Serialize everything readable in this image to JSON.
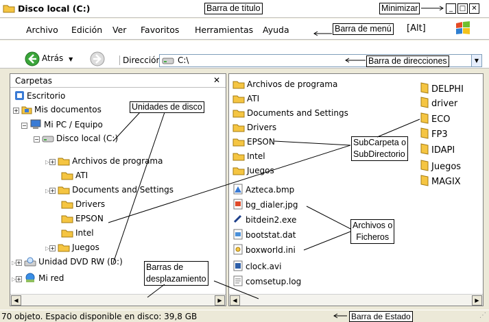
{
  "window": {
    "title": "Disco local (C:)"
  },
  "menubar": {
    "items": [
      "Archivo",
      "Edición",
      "Ver",
      "Favoritos",
      "Herramientas",
      "Ayuda"
    ]
  },
  "toolbar": {
    "back_label": "Atrás",
    "address_label": "Dirección",
    "address_value": "C:\\"
  },
  "folders_pane": {
    "title": "Carpetas",
    "close_glyph": "✕",
    "tree": [
      {
        "label": "Escritorio"
      },
      {
        "label": "Mis documentos"
      },
      {
        "label": "Mi PC / Equipo"
      },
      {
        "label": "Disco local (C:)"
      },
      {
        "label": "Archivos de programa"
      },
      {
        "label": "ATI"
      },
      {
        "label": "Documents and Settings"
      },
      {
        "label": "Drivers"
      },
      {
        "label": "EPSON"
      },
      {
        "label": "Intel"
      },
      {
        "label": "Juegos"
      },
      {
        "label": "Unidad DVD RW (D:)"
      },
      {
        "label": "Mi red"
      }
    ]
  },
  "contents": {
    "folders": [
      "Archivos de programa",
      "ATI",
      "Documents and Settings",
      "Drivers",
      "EPSON",
      "Intel",
      "Juegos"
    ],
    "files": [
      "Azteca.bmp",
      "bg_dialer.jpg",
      "bitdein2.exe",
      "bootstat.dat",
      "boxworld.ini",
      "clock.avi",
      "comsetup.log"
    ],
    "folders_right": [
      "DELPHI",
      "driver",
      "ECO",
      "FP3",
      "IDAPI",
      "Juegos",
      "MAGIX"
    ]
  },
  "status": {
    "text": "70 objeto. Espacio disponible en disco:  39,8 GB"
  },
  "annotations": {
    "title_bar": "Barra de título",
    "minimize": "Minimizar",
    "menu_bar": "Barra de menú",
    "menu_bar_key": "[Alt]",
    "address_bar": "Barra de direcciones",
    "drive_units": "Unidades de disco",
    "subfolder_1": "SubCarpeta o",
    "subfolder_2": "SubDirectorio",
    "files_1": "Archivos o",
    "files_2": "Ficheros",
    "scrollbars_1": "Barras de",
    "scrollbars_2": "desplazamiento",
    "status_bar": "Barra de Estado"
  },
  "colors": {
    "folder": "#f5c542",
    "folder_dark": "#d9a520",
    "selection": "#316ac5",
    "callout_line": "#000000",
    "back_green": "#3aa53a"
  }
}
